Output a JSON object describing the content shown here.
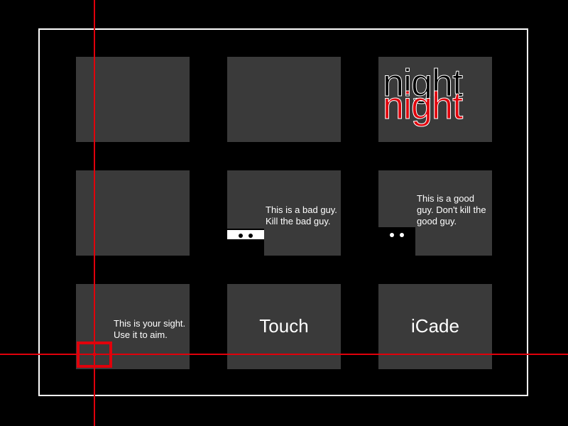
{
  "logo": {
    "word_top": "night",
    "word_bottom": "night"
  },
  "tiles": {
    "bad_guy_text": "This is a bad guy.\nKill the bad guy.",
    "good_guy_text": "This is a good\nguy. Don't kill the\ngood guy.",
    "sight_text": "This is your sight.\nUse it to aim.",
    "touch_label": "Touch",
    "icade_label": "iCade"
  },
  "colors": {
    "background": "#000000",
    "tile": "#3a3a3a",
    "accent_red": "#e0000b",
    "text": "#ffffff"
  },
  "icons": {
    "bad_guy": "bad-guy-character-icon",
    "good_guy": "good-guy-character-icon",
    "sight": "crosshair-sight-icon"
  }
}
